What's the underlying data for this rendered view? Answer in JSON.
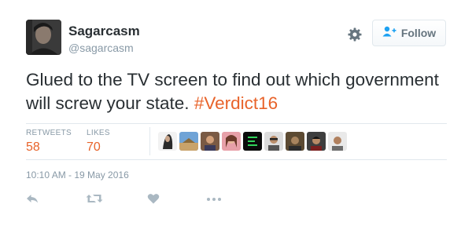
{
  "user": {
    "display_name": "Sagarcasm",
    "handle": "@sagarcasm"
  },
  "header": {
    "follow_label": "Follow",
    "icons": [
      "gear-icon",
      "follow-person-icon"
    ]
  },
  "tweet": {
    "text": "Glued to the TV screen to find out which government will screw your state.",
    "hashtag": "#Verdict16"
  },
  "stats": {
    "retweets_label": "RETWEETS",
    "retweets_count": "58",
    "likes_label": "LIKES",
    "likes_count": "70"
  },
  "likers_count_shown": 9,
  "timestamp": "10:10 AM - 19 May 2016",
  "actions": [
    "reply-icon",
    "retweet-icon",
    "like-icon",
    "more-icon"
  ],
  "colors": {
    "accent": "#e8632a",
    "text": "#292f33",
    "muted": "#8899a6",
    "divider": "#e1e8ed",
    "icon": "#aab8c2"
  }
}
